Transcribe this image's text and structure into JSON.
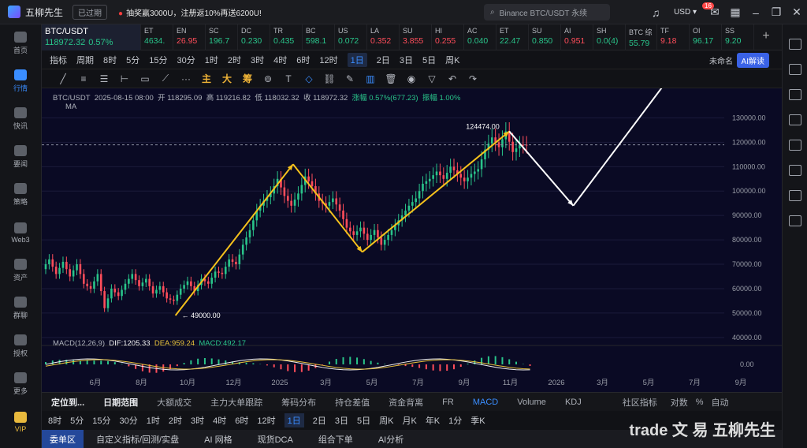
{
  "app": {
    "name": "五柳先生",
    "expired": "已过期",
    "promo": "抽奖赢3000U，注册返10%再送6200U!",
    "search_placeholder": "Binance BTC/USDT 永续",
    "currency": "USD",
    "notif_count": "16"
  },
  "nav": [
    {
      "label": "首页"
    },
    {
      "label": "行情"
    },
    {
      "label": "快讯"
    },
    {
      "label": "要闻"
    },
    {
      "label": "策略"
    },
    {
      "label": "Web3"
    },
    {
      "label": "资产"
    },
    {
      "label": "群聊"
    },
    {
      "label": "授权"
    },
    {
      "label": "更多"
    },
    {
      "label": "VIP"
    }
  ],
  "tickers": [
    {
      "sym": "BTC/USDT",
      "px": "118972.32",
      "chg": "0.57%",
      "dir": "up",
      "main": true
    },
    {
      "sym": "ET",
      "px": "4634.",
      "dir": "up"
    },
    {
      "sym": "EN",
      "px": "26.95",
      "dir": "dn"
    },
    {
      "sym": "SC",
      "px": "196.7",
      "dir": "up"
    },
    {
      "sym": "DC",
      "px": "0.230",
      "dir": "up"
    },
    {
      "sym": "TR",
      "px": "0.435",
      "dir": "up"
    },
    {
      "sym": "BC",
      "px": "598.1",
      "dir": "up"
    },
    {
      "sym": "US",
      "px": "0.072",
      "dir": "up"
    },
    {
      "sym": "LA",
      "px": "0.352",
      "dir": "dn"
    },
    {
      "sym": "SU",
      "px": "3.855",
      "dir": "dn"
    },
    {
      "sym": "HI",
      "px": "0.255",
      "dir": "dn"
    },
    {
      "sym": "AC",
      "px": "0.040",
      "dir": "up"
    },
    {
      "sym": "ET",
      "px": "22.47",
      "dir": "up"
    },
    {
      "sym": "SU",
      "px": "0.850",
      "dir": "up"
    },
    {
      "sym": "AI",
      "px": "0.951",
      "dir": "dn"
    },
    {
      "sym": "SH",
      "px": "0.0(4)",
      "dir": "up"
    },
    {
      "sym": "BTC 综",
      "px": "55.79",
      "dir": "up"
    },
    {
      "sym": "TF",
      "px": "9.18",
      "dir": "dn"
    },
    {
      "sym": "OI",
      "px": "96.17",
      "dir": "up"
    },
    {
      "sym": "SS",
      "px": "9.20",
      "dir": "up"
    }
  ],
  "toolbar1": [
    "指标",
    "周期",
    "8时",
    "5分",
    "15分",
    "30分",
    "1时",
    "2时",
    "3时",
    "4时",
    "6时",
    "12时",
    "1日",
    "2日",
    "3日",
    "5日",
    "周K"
  ],
  "toolbar1_selected": "1日",
  "unnamed": "未命名",
  "ai_btn": "AI解读",
  "draw_tools": [
    "主",
    "大",
    "筹"
  ],
  "legend": {
    "pair": "BTC/USDT",
    "date": "2025-08-15 08:00",
    "open": "开 118295.09",
    "high": "高 119216.82",
    "low": "低 118032.32",
    "close": "收 118972.32",
    "chg": "涨幅 0.57%(677.23)",
    "amp": "振幅 1.00%",
    "ma": "MA"
  },
  "macd": {
    "name": "MACD(12,26,9)",
    "dif": "DIF:1205.33",
    "dea": "DEA:959.24",
    "macd": "MACD:492.17"
  },
  "bottom1": [
    "定位到...",
    "日期范围",
    "大额成交",
    "主力大单跟踪",
    "筹码分布",
    "持仓差值",
    "资金背离",
    "FR",
    "MACD",
    "Volume",
    "KDJ",
    "社区指标",
    "对数",
    "%",
    "自动"
  ],
  "bottom1_selected": "MACD",
  "bottom2": [
    "8时",
    "5分",
    "15分",
    "30分",
    "1时",
    "2时",
    "3时",
    "4时",
    "6时",
    "12时",
    "1日",
    "2日",
    "3日",
    "5日",
    "周K",
    "月K",
    "年K",
    "1分",
    "季K"
  ],
  "bottom2_selected": "1日",
  "bottom3": [
    "委单区",
    "自定义指标/回测/实盘",
    "AI 网格",
    "现货DCA",
    "组合下单",
    "AI分析"
  ],
  "watermark": "trade 文 易 五柳先生",
  "chart_data": {
    "type": "line",
    "ylim": [
      38000,
      135000
    ],
    "y_ticks": [
      "130000.00",
      "120000.00",
      "110000.00",
      "100000.00",
      "90000.00",
      "80000.00",
      "70000.00",
      "60000.00",
      "50000.00",
      "40000.00"
    ],
    "x_ticks": [
      "6月",
      "8月",
      "10月",
      "12月",
      "2025",
      "3月",
      "5月",
      "7月",
      "9月",
      "11月",
      "2026",
      "3月",
      "5月",
      "7月",
      "9月"
    ],
    "high_label": "124474.00",
    "low_label": "49000.00",
    "current_price": "118972.32",
    "macd_zero_label": "0.00",
    "price_path": [
      [
        0,
        68000
      ],
      [
        4,
        72000
      ],
      [
        8,
        66000
      ],
      [
        12,
        71000
      ],
      [
        16,
        65000
      ],
      [
        20,
        70000
      ],
      [
        24,
        62000
      ],
      [
        28,
        60000
      ],
      [
        32,
        66000
      ],
      [
        36,
        52000
      ],
      [
        40,
        60000
      ],
      [
        44,
        57000
      ],
      [
        48,
        62000
      ],
      [
        52,
        66000
      ],
      [
        56,
        61000
      ],
      [
        60,
        64000
      ],
      [
        64,
        58000
      ],
      [
        68,
        61000
      ],
      [
        72,
        56000
      ],
      [
        76,
        55000
      ],
      [
        80,
        60000
      ],
      [
        84,
        63000
      ],
      [
        88,
        59000
      ],
      [
        92,
        64000
      ],
      [
        96,
        62000
      ],
      [
        100,
        67000
      ],
      [
        104,
        66000
      ],
      [
        108,
        72000
      ],
      [
        112,
        70000
      ],
      [
        116,
        78000
      ],
      [
        120,
        84000
      ],
      [
        124,
        92000
      ],
      [
        128,
        96000
      ],
      [
        132,
        99000
      ],
      [
        136,
        105000
      ],
      [
        140,
        98000
      ],
      [
        144,
        94000
      ],
      [
        148,
        99000
      ],
      [
        152,
        106000
      ],
      [
        156,
        102000
      ],
      [
        160,
        96000
      ],
      [
        164,
        94000
      ],
      [
        168,
        97000
      ],
      [
        172,
        92000
      ],
      [
        176,
        85000
      ],
      [
        180,
        82000
      ],
      [
        184,
        85000
      ],
      [
        188,
        80000
      ],
      [
        192,
        84000
      ],
      [
        196,
        78000
      ],
      [
        200,
        82000
      ],
      [
        204,
        86000
      ],
      [
        208,
        90000
      ],
      [
        212,
        94000
      ],
      [
        216,
        97000
      ],
      [
        220,
        103000
      ],
      [
        224,
        105000
      ],
      [
        228,
        108000
      ],
      [
        232,
        105000
      ],
      [
        236,
        110000
      ],
      [
        240,
        107000
      ],
      [
        244,
        104000
      ],
      [
        248,
        107000
      ],
      [
        252,
        109000
      ],
      [
        256,
        117000
      ],
      [
        260,
        122000
      ],
      [
        264,
        118000
      ],
      [
        268,
        124474
      ],
      [
        272,
        116000
      ],
      [
        276,
        119000
      ],
      [
        280,
        118972
      ]
    ],
    "arrows": [
      {
        "from": [
          75,
          49000
        ],
        "to": [
          143,
          111000
        ],
        "color": "#f5c11c"
      },
      {
        "from": [
          143,
          111000
        ],
        "to": [
          183,
          75000
        ],
        "color": "#f5c11c"
      },
      {
        "from": [
          183,
          75000
        ],
        "to": [
          268,
          124474
        ],
        "color": "#f5c11c"
      },
      {
        "from": [
          268,
          124474
        ],
        "to": [
          305,
          94000
        ],
        "color": "#ffffff"
      },
      {
        "from": [
          305,
          94000
        ],
        "to": [
          360,
          146000
        ],
        "color": "#ffffff"
      }
    ]
  }
}
